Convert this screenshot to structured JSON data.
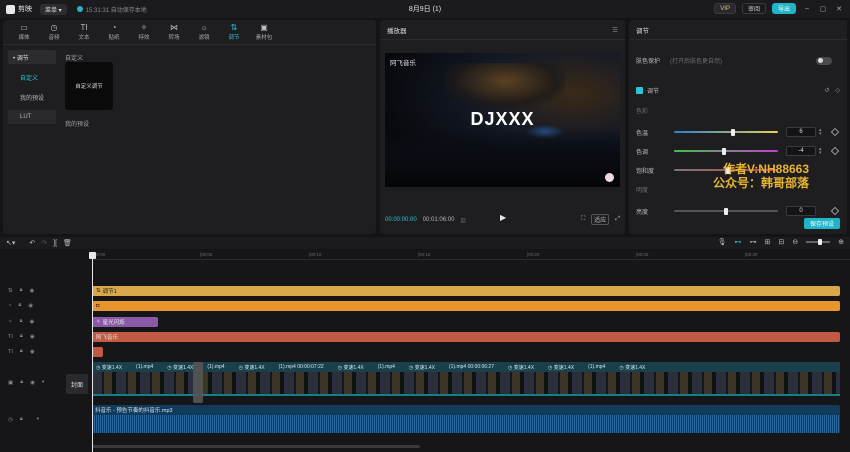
{
  "app": {
    "name": "剪映",
    "menu_label": "菜单 ▾",
    "autosave": "15:31:31 自动保存本地",
    "project_title": "8月9日 (1)"
  },
  "top_right": {
    "vip": "VIP",
    "share": "审阅",
    "export": "导出"
  },
  "toolbar": [
    {
      "icon": "media-icon",
      "glyph": "▭",
      "label": "媒体"
    },
    {
      "icon": "audio-icon",
      "glyph": "◷",
      "label": "音频"
    },
    {
      "icon": "text-icon",
      "glyph": "TI",
      "label": "文本"
    },
    {
      "icon": "sticker-icon",
      "glyph": "◔",
      "label": "贴纸"
    },
    {
      "icon": "effects-icon",
      "glyph": "✧",
      "label": "特效"
    },
    {
      "icon": "transition-icon",
      "glyph": "⋈",
      "label": "转场"
    },
    {
      "icon": "filter-icon",
      "glyph": "☼",
      "label": "滤镜"
    },
    {
      "icon": "adjust-icon",
      "glyph": "⇅",
      "label": "调节"
    },
    {
      "icon": "template-icon",
      "glyph": "▣",
      "label": "素材包"
    }
  ],
  "left_nav": {
    "parent": "• 调节",
    "items": [
      "自定义",
      "我的预设",
      "LUT"
    ]
  },
  "left_content": {
    "custom_title": "自定义",
    "custom_card": "自定义调节",
    "preset_title": "我的预设"
  },
  "player": {
    "title": "播放器",
    "video_label": "阿飞音乐",
    "video_title": "DJXXX",
    "time_current": "00:00:00:00",
    "time_total": "00:01:06:00",
    "ratio": "适应"
  },
  "adjust": {
    "title": "调节",
    "skin_label": "肤色保护",
    "skin_hint": "(打开后肤色更自然)",
    "section": "调节",
    "group_color": "色彩",
    "sliders": [
      {
        "label": "色温",
        "value": "6",
        "fraction": 0.55
      },
      {
        "label": "色调",
        "value": "-4",
        "fraction": 0.46
      },
      {
        "label": "饱和度",
        "value": "",
        "fraction": 0.5
      }
    ],
    "group_light": "明度",
    "bright_label": "亮度",
    "bright_value": "0",
    "save_btn": "保存预设",
    "watermark_line1": "作者V:NH88663",
    "watermark_line2": "公众号：韩哥部落"
  },
  "ruler_ticks": [
    "00:00",
    "|00:05",
    "|00:10",
    "|00:15",
    "|00:20",
    "|00:25",
    "|00:30"
  ],
  "tracks": {
    "adjust_clip": "调节1",
    "effect_clip": "星光闪烁",
    "text_clip": "阿飞音乐",
    "fx_labels": [
      "◷ 变速1.4X",
      "(1).mp4",
      "◷ 变速1.4X",
      "(1).mp4",
      "◷ 变速1.4X",
      "(1).mp4  00:00:07:22",
      "◷ 变速1.4X",
      "(1).mp4",
      "◷ 变速1.4X",
      "(1).mp4  00:00:06:27",
      "◷ 变速1.4X",
      "◷ 变速1.4X",
      "(1).mp4",
      "◷ 变速1.4X"
    ],
    "cover": "封面",
    "audio_label": "抖音乐 - 预告节奏的抖音乐.mp3"
  },
  "colors": {
    "accent": "#2dc4d6",
    "adjust_clip": "#d8a84a",
    "orange_clip": "#e8952e",
    "effect_clip": "#8a5aa8",
    "text_clip": "#c05a44"
  }
}
